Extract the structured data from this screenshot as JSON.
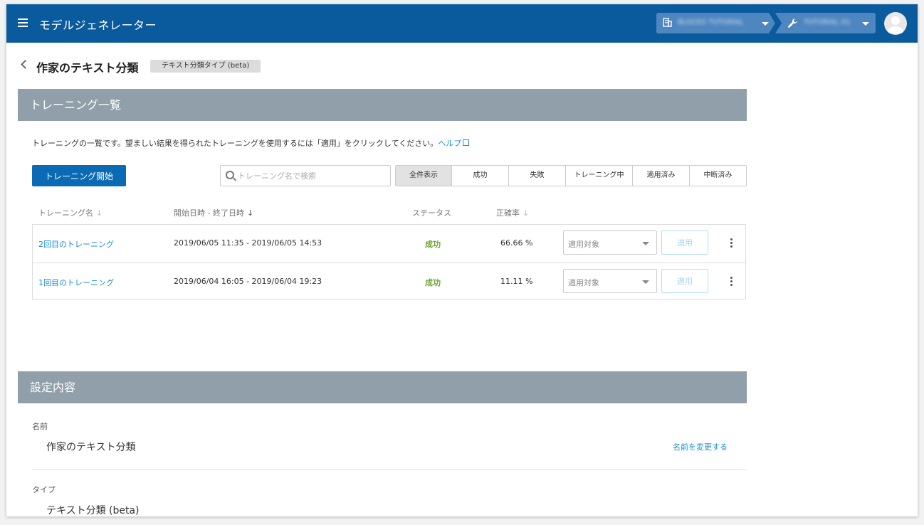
{
  "header": {
    "app_title": "モデルジェネレーター",
    "org_label": "BLOCKS TUTORIAL",
    "project_label": "TUTORIAL 01"
  },
  "page": {
    "title": "作家のテキスト分類",
    "type_badge": "テキスト分類タイプ (beta)"
  },
  "training": {
    "section_title": "トレーニング一覧",
    "description": "トレーニングの一覧です。望ましい結果を得られたトレーニングを使用するには「適用」をクリックしてください。",
    "help_label": "ヘルプ",
    "start_button": "トレーニング開始",
    "search_placeholder": "トレーニング名で検索",
    "filters": [
      {
        "label": "全件表示",
        "active": true
      },
      {
        "label": "成功",
        "active": false
      },
      {
        "label": "失敗",
        "active": false
      },
      {
        "label": "トレーニング中",
        "active": false
      },
      {
        "label": "適用済み",
        "active": false
      },
      {
        "label": "中断済み",
        "active": false
      }
    ],
    "columns": {
      "name": "トレーニング名",
      "period": "開始日時 - 終了日時",
      "status": "ステータス",
      "accuracy": "正確率"
    },
    "rows": [
      {
        "name": "2回目のトレーニング",
        "period": "2019/06/05 11:35 - 2019/06/05 14:53",
        "status": "成功",
        "accuracy": "66.66 %",
        "target_placeholder": "適用対象",
        "apply_label": "適用"
      },
      {
        "name": "1回目のトレーニング",
        "period": "2019/06/04 16:05 - 2019/06/04 19:23",
        "status": "成功",
        "accuracy": "11.11 %",
        "target_placeholder": "適用対象",
        "apply_label": "適用"
      }
    ]
  },
  "settings": {
    "section_title": "設定内容",
    "name_label": "名前",
    "name_value": "作家のテキスト分類",
    "rename_link": "名前を変更する",
    "type_label": "タイプ",
    "type_value": "テキスト分類 (beta)"
  },
  "colors": {
    "topbar": "#0a5a9e",
    "section_header": "#909fa9",
    "primary_button": "#0a6ab4",
    "link": "#1a90d0",
    "success": "#6aa632"
  }
}
